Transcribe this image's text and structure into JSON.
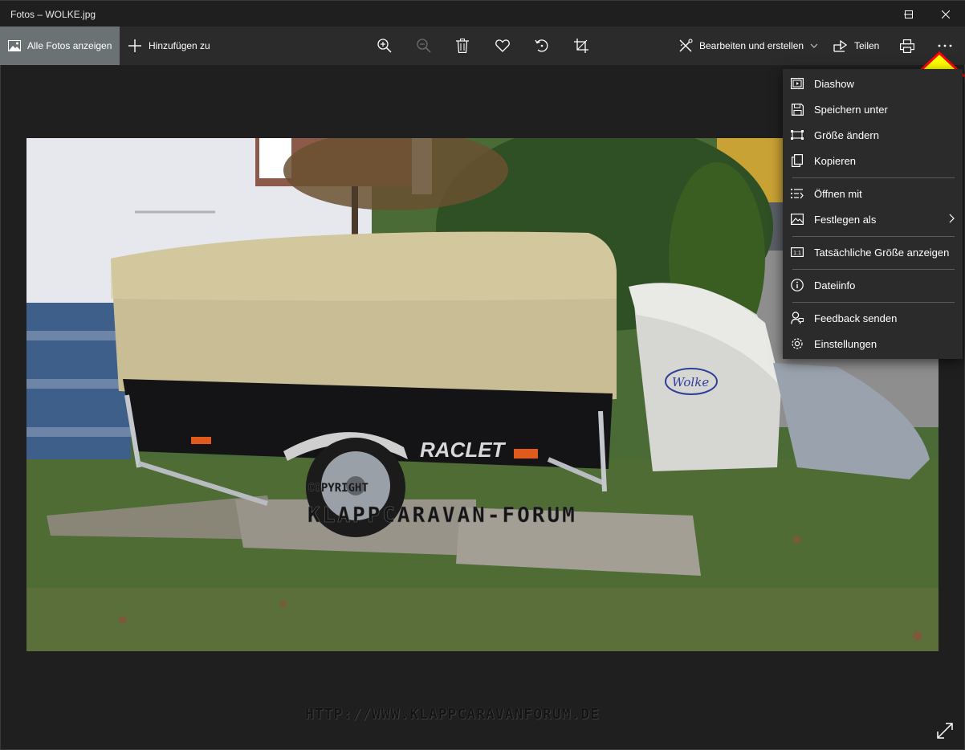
{
  "window": {
    "title": "Fotos – WOLKE.jpg",
    "controls": [
      "minimize-icon",
      "maximize-icon",
      "close-icon"
    ]
  },
  "toolbar": {
    "all_photos_label": "Alle Fotos anzeigen",
    "add_to_label": "Hinzufügen zu",
    "icons": [
      "zoom-in-icon",
      "zoom-out-icon",
      "delete-icon",
      "favorite-icon",
      "rotate-icon",
      "crop-icon"
    ],
    "edit_label": "Bearbeiten und erstellen",
    "share_label": "Teilen",
    "print_icon": "print-icon",
    "more_icon": "more-icon"
  },
  "photo": {
    "trailer_brand": "RACLET",
    "box_brand": "Wolke",
    "watermark_line1": "COPYRIGHT",
    "watermark_line2": "KLAPPCARAVAN-FORUM"
  },
  "watermark_url": "HTTP://WWW.KLAPPCARAVANFORUM.DE",
  "menu": {
    "items": [
      {
        "label": "Diashow",
        "icon": "slideshow-icon"
      },
      {
        "label": "Speichern unter",
        "icon": "save-icon"
      },
      {
        "label": "Größe ändern",
        "icon": "resize-icon"
      },
      {
        "label": "Kopieren",
        "icon": "copy-icon"
      },
      {
        "label": "Öffnen mit",
        "icon": "open-with-icon"
      },
      {
        "label": "Festlegen als",
        "icon": "set-as-icon",
        "submenu": true
      },
      {
        "label": "Tatsächliche Größe anzeigen",
        "icon": "actual-size-icon"
      },
      {
        "label": "Dateiinfo",
        "icon": "info-icon"
      },
      {
        "label": "Feedback senden",
        "icon": "feedback-icon"
      },
      {
        "label": "Einstellungen",
        "icon": "settings-icon"
      }
    ]
  },
  "colors": {
    "toolbar_bg": "#2b2b2b",
    "active_tab_bg": "#6b7273",
    "menu_bg": "#2b2b2b",
    "arrow_fill": "#ffff00",
    "arrow_outline": "#ff0000"
  }
}
